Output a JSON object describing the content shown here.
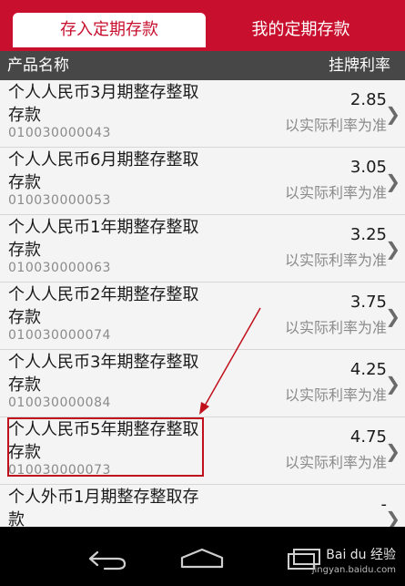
{
  "tabs": {
    "active": "存入定期存款",
    "inactive": "我的定期存款"
  },
  "table_header": {
    "left": "产品名称",
    "right": "挂牌利率"
  },
  "rows": [
    {
      "name": "个人人民币3月期整存整取存款",
      "code": "010030000043",
      "rate": "2.85",
      "note": "以实际利率为准"
    },
    {
      "name": "个人人民币6月期整存整取存款",
      "code": "010030000053",
      "rate": "3.05",
      "note": "以实际利率为准"
    },
    {
      "name": "个人人民币1年期整存整取存款",
      "code": "010030000063",
      "rate": "3.25",
      "note": "以实际利率为准"
    },
    {
      "name": "个人人民币2年期整存整取存款",
      "code": "010030000074",
      "rate": "3.75",
      "note": "以实际利率为准"
    },
    {
      "name": "个人人民币3年期整存整取存款",
      "code": "010030000084",
      "rate": "4.25",
      "note": "以实际利率为准"
    },
    {
      "name": "个人人民币5年期整存整取存款",
      "code": "010030000073",
      "rate": "4.75",
      "note": "以实际利率为准"
    },
    {
      "name": "个人外币1月期整存整取存款",
      "code": "",
      "rate": "-",
      "note": ""
    }
  ],
  "icons": {
    "chevron": "chevron-right-icon",
    "back": "back-icon",
    "home": "home-icon",
    "recents": "recents-icon"
  },
  "watermark": {
    "text": "Bai du 经验",
    "sub": "jingyan.baidu.com"
  },
  "colors": {
    "brand": "#c8102e",
    "header_bar": "#474747",
    "annotation": "#c0101c"
  }
}
